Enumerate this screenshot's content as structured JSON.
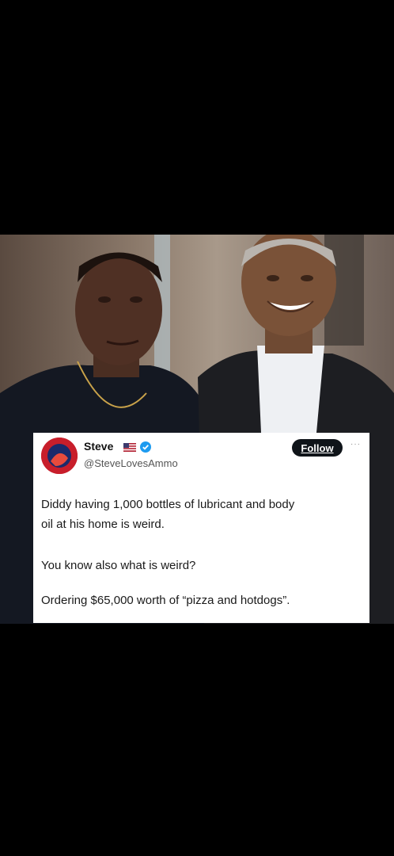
{
  "tweet": {
    "display_name": "Steve",
    "handle": "@SteveLovesAmmo",
    "follow_label": "Follow",
    "more_label": "···",
    "text_lines": [
      "Diddy having 1,000 bottles of lubricant and body",
      "oil at his home is weird.",
      "You know also what is weird?",
      "Ordering $65,000 worth of “pizza and hotdogs”."
    ]
  },
  "icons": {
    "flag": "us-flag-icon",
    "verified": "verified-badge-icon",
    "more": "more-options-icon"
  },
  "colors": {
    "background": "#000000",
    "card": "#ffffff",
    "follow_button": "#0f1419",
    "verified": "#1d9bf0",
    "avatar": "#c81e2b"
  }
}
